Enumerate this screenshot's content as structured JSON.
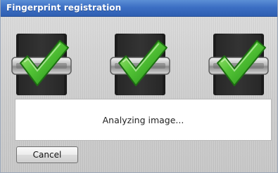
{
  "window": {
    "title": "Fingerprint registration"
  },
  "steps": [
    {
      "icon": "fingerprint-sensor-check-icon",
      "state": "complete"
    },
    {
      "icon": "fingerprint-sensor-check-icon",
      "state": "complete"
    },
    {
      "icon": "fingerprint-sensor-check-icon",
      "state": "complete"
    }
  ],
  "status": {
    "message": "Analyzing image..."
  },
  "buttons": {
    "cancel_label": "Cancel"
  },
  "colors": {
    "title_bar": "#3c6fc4",
    "check_green": "#3fae2a",
    "sensor_dark": "#2b2b2b"
  }
}
